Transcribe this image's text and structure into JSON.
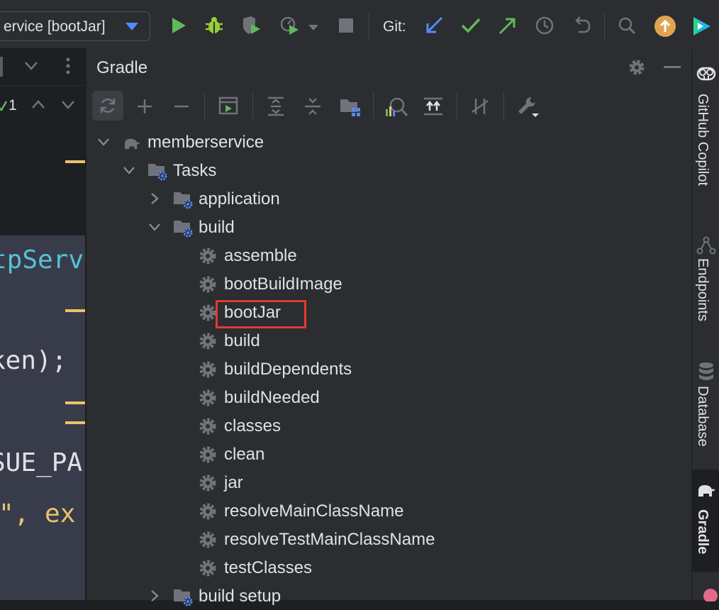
{
  "toolbar": {
    "run_config": "ervice [bootJar]",
    "git_label": "Git:",
    "icons": [
      "run-icon",
      "debug-icon",
      "coverage-icon",
      "profile-icon",
      "stop-icon",
      "git-update-icon",
      "git-commit-icon",
      "git-push-icon",
      "history-icon",
      "rollback-icon",
      "search-icon",
      "update-icon",
      "toolbox-icon"
    ]
  },
  "editor": {
    "problems_count": "1",
    "code_lines": [
      "tpServ",
      "ken);",
      "SUE_PA",
      "\", ex"
    ]
  },
  "gradle": {
    "title": "Gradle",
    "tree": {
      "root": "memberservice",
      "tasks": "Tasks",
      "application": "application",
      "build_group": "build",
      "build_tasks": [
        "assemble",
        "bootBuildImage",
        "bootJar",
        "build",
        "buildDependents",
        "buildNeeded",
        "classes",
        "clean",
        "jar",
        "resolveMainClassName",
        "resolveTestMainClassName",
        "testClasses"
      ],
      "next_group": "build setup"
    },
    "selected_task": "bootJar"
  },
  "sidebar": {
    "tabs": [
      "GitHub Copilot",
      "Endpoints",
      "Database",
      "Gradle"
    ],
    "active": "Gradle"
  },
  "colors": {
    "accent": "#548af7",
    "run_green": "#5fb85c",
    "highlight_red": "#e5392e",
    "code_cyan": "#56c2d6",
    "code_yellow": "#e8c46a"
  }
}
